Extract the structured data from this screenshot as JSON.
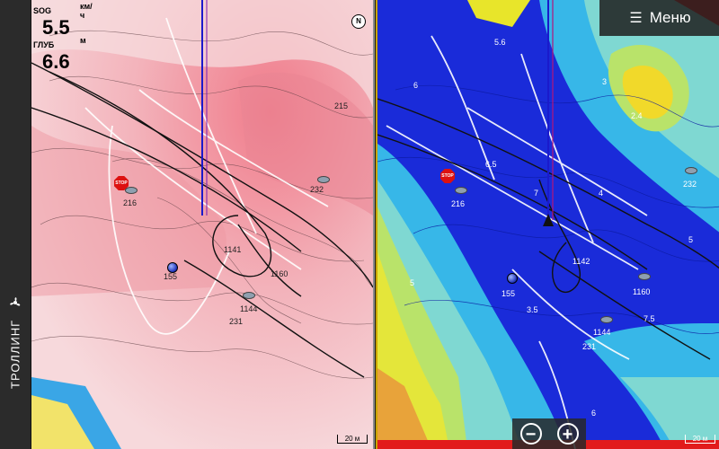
{
  "sidebar": {
    "tab_label": "ТРОЛЛИНГ"
  },
  "left_chart": {
    "sog_label": "SOG",
    "sog_unit": "км/ч",
    "sog_value": "5.5",
    "depth_label": "ГЛУБ",
    "depth_unit": "м",
    "depth_value": "6.6",
    "north_label": "N",
    "scale_label": "20 м",
    "waypoints": [
      {
        "name": "215"
      },
      {
        "name": "232"
      },
      {
        "name": "216"
      },
      {
        "name": "155"
      },
      {
        "name": "1160"
      },
      {
        "name": "1144"
      },
      {
        "name": "231"
      },
      {
        "name": "1141"
      }
    ],
    "stop_label": "STOP"
  },
  "right_chart": {
    "menu_label": "Меню",
    "scale_label": "20 м",
    "zoom_out": "−",
    "zoom_in": "+",
    "waypoints": [
      {
        "name": "232"
      },
      {
        "name": "216"
      },
      {
        "name": "155"
      },
      {
        "name": "1160"
      },
      {
        "name": "1144"
      },
      {
        "name": "231"
      },
      {
        "name": "1142"
      }
    ],
    "stop_label": "STOP",
    "depth_marks": [
      "5.6",
      "6",
      "4",
      "3",
      "7",
      "5",
      "6.5",
      "5",
      "3.5",
      "2.4",
      "7.5",
      "6"
    ]
  },
  "colors": {
    "left_base": "#f2c9cf",
    "right_deep": "#1a2bd9",
    "right_shallow": "#e8e52a",
    "track_vessel": "#1a1acc"
  }
}
